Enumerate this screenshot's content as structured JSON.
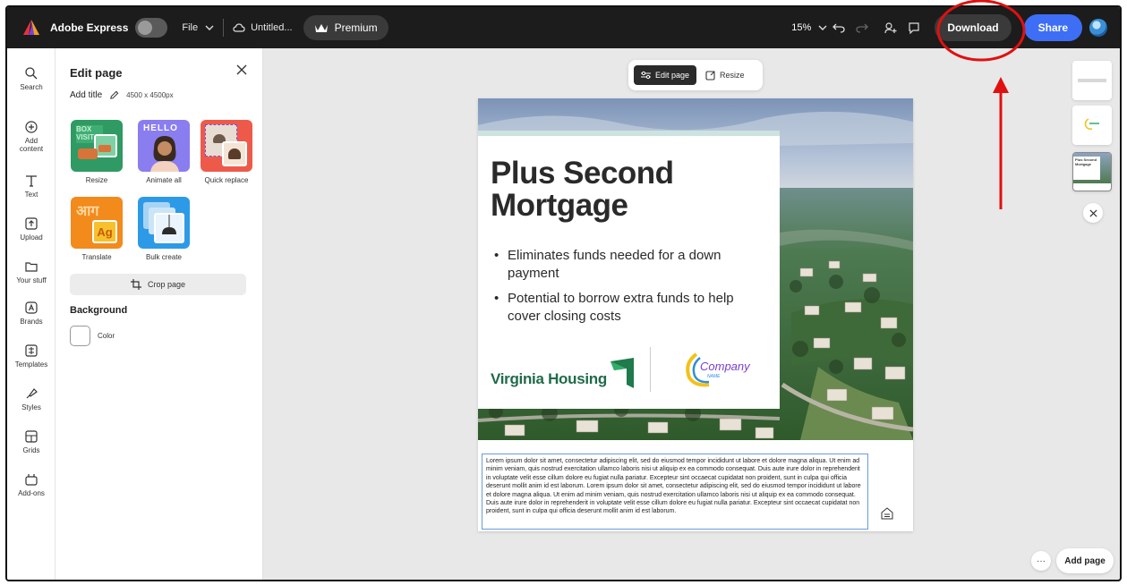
{
  "topbar": {
    "app_name": "Adobe Express",
    "file_label": "File",
    "doc_title": "Untitled...",
    "premium_label": "Premium",
    "zoom": "15%",
    "download_label": "Download",
    "share_label": "Share"
  },
  "rail": {
    "items": [
      {
        "label": "Search",
        "icon": "search-icon"
      },
      {
        "label": "Add content",
        "icon": "plus-circle-icon"
      },
      {
        "label": "Text",
        "icon": "text-icon"
      },
      {
        "label": "Upload",
        "icon": "upload-icon"
      },
      {
        "label": "Your stuff",
        "icon": "folder-icon"
      },
      {
        "label": "Brands",
        "icon": "brand-icon"
      },
      {
        "label": "Templates",
        "icon": "templates-icon"
      },
      {
        "label": "Styles",
        "icon": "styles-icon"
      },
      {
        "label": "Grids",
        "icon": "grid-icon"
      },
      {
        "label": "Add-ons",
        "icon": "addons-icon"
      }
    ]
  },
  "panel": {
    "title": "Edit page",
    "add_title": "Add title",
    "dimensions": "4500 x 4500px",
    "tiles": [
      {
        "label": "Resize",
        "tile_text": "BOX\nVISIT"
      },
      {
        "label": "Animate all",
        "tile_text": "HELLO"
      },
      {
        "label": "Quick replace",
        "tile_text": ""
      },
      {
        "label": "Translate",
        "tile_text": "आग"
      },
      {
        "label": "Bulk create",
        "tile_text": ""
      }
    ],
    "translate_badge": "Ag",
    "crop_label": "Crop page",
    "background_heading": "Background",
    "color_label": "Color"
  },
  "canvas_toolbar": {
    "edit_label": "Edit page",
    "resize_label": "Resize"
  },
  "flyer": {
    "headline_line1": "Plus Second",
    "headline_line2": "Mortgage",
    "bullet1": "Eliminates funds needed for a down payment",
    "bullet2": "Potential to borrow extra funds to help cover closing costs",
    "brand_name": "Virginia Housing",
    "company_word": "Company",
    "company_sub": "NAME",
    "lorem": "Lorem ipsum dolor sit amet, consectetur adipiscing elit, sed do eiusmod tempor incididunt ut labore et dolore magna aliqua. Ut enim ad minim veniam, quis nostrud exercitation ullamco laboris nisi ut aliquip ex ea commodo consequat. Duis aute irure dolor in reprehenderit in voluptate velit esse cillum dolore eu fugiat nulla pariatur. Excepteur sint occaecat cupidatat non proident, sunt in culpa qui officia deserunt mollit anim id est laborum. Lorem ipsum dolor sit amet, consectetur adipiscing elit, sed do eiusmod tempor incididunt ut labore et dolore magna aliqua. Ut enim ad minim veniam, quis nostrud exercitation ullamco laboris nisi ut aliquip ex ea commodo consequat. Duis aute irure dolor in reprehenderit in voluptate velit esse cillum dolore eu fugiat nulla pariatur. Excepteur sint occaecat cupidatat non proident, sunt in culpa qui officia deserunt mollit anim id est laborum."
  },
  "thumbnails": {
    "thumb3_line1": "Plus Second",
    "thumb3_line2": "Mortgage"
  },
  "bottom": {
    "more_label": "···",
    "add_page_label": "Add page"
  },
  "colors": {
    "topbar": "#1c1c1c",
    "share": "#3d6ef5",
    "annotation": "#e01010",
    "brand_green": "#1f6b4a"
  }
}
